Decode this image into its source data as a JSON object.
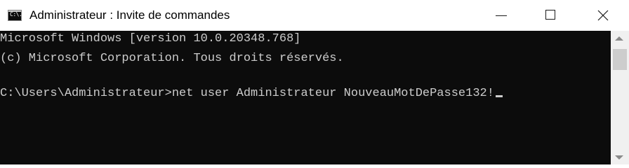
{
  "window": {
    "title": "Administrateur : Invite de commandes",
    "icon": "cmd-icon",
    "icon_glyph": "C:\\."
  },
  "caption_buttons": {
    "minimize": "minimize-icon",
    "maximize": "maximize-icon",
    "close": "close-icon"
  },
  "console": {
    "lines": [
      "Microsoft Windows [version 10.0.20348.768]",
      "(c) Microsoft Corporation. Tous droits réservés.",
      "C:\\Users\\Administrateur>net user Administrateur NouveauMotDePasse132!"
    ],
    "prompt": "C:\\Users\\Administrateur>",
    "command": "net user Administrateur NouveauMotDePasse132!",
    "background_color": "#0c0c0c",
    "text_color": "#cccccc"
  },
  "scrollbar": {
    "up": "scroll-up-arrow-icon",
    "down": "scroll-down-arrow-icon"
  }
}
